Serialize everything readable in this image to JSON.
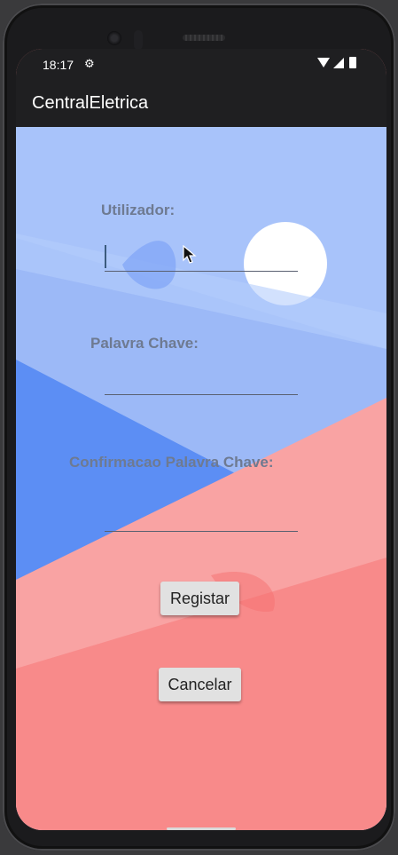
{
  "status_bar": {
    "time": "18:17",
    "settings_icon": "gear-icon",
    "icons": [
      "wifi-icon",
      "signal-icon",
      "battery-icon"
    ]
  },
  "app_bar": {
    "title": "CentralEletrica"
  },
  "form": {
    "username_label": "Utilizador:",
    "username_value": "",
    "password_label": "Palavra Chave:",
    "password_value": "",
    "confirm_label": "Confirmacao Palavra Chave:",
    "confirm_value": ""
  },
  "buttons": {
    "register_label": "Registar",
    "cancel_label": "Cancelar"
  },
  "colors": {
    "sky": "#a8c3fa",
    "blue": "#5c8ef4",
    "pink": "#f9a3a3",
    "coral": "#f88a8a",
    "bar": "#1f1f21"
  }
}
